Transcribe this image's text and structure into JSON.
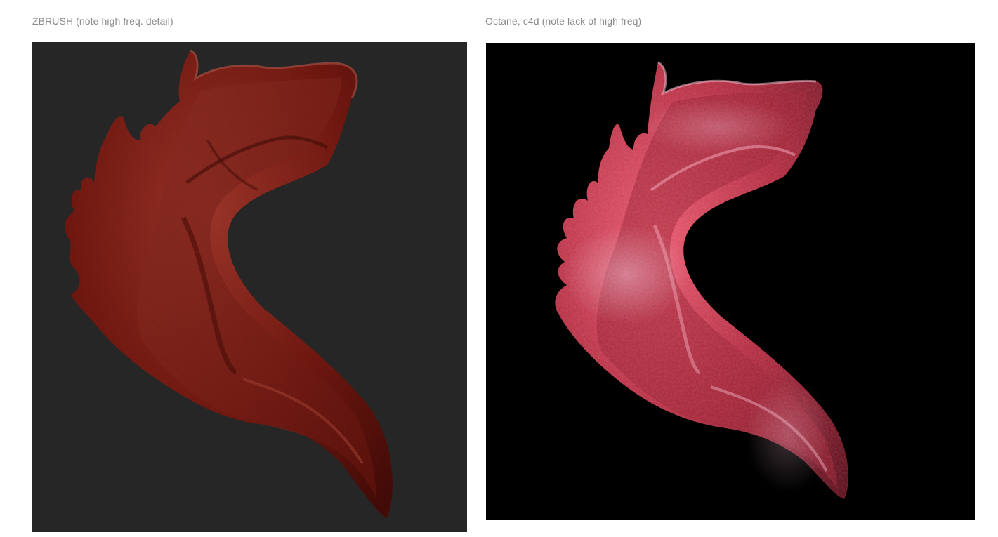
{
  "panels": [
    {
      "caption": "ZBRUSH (note high freq. detail)",
      "colors": {
        "background": "#262626",
        "base": "#7a1a12",
        "light": "#a8392c",
        "dark": "#3f0a06",
        "specular": "#c98a80"
      },
      "image": "red sculpted creature relief render"
    },
    {
      "caption": "Octane, c4d (note lack of high freq)",
      "colors": {
        "background": "#000000",
        "base": "#b0283c",
        "light": "#e8566a",
        "dark": "#4a0a14",
        "specular": "#f2c8dc"
      },
      "image": "red glossy creature relief render"
    }
  ]
}
